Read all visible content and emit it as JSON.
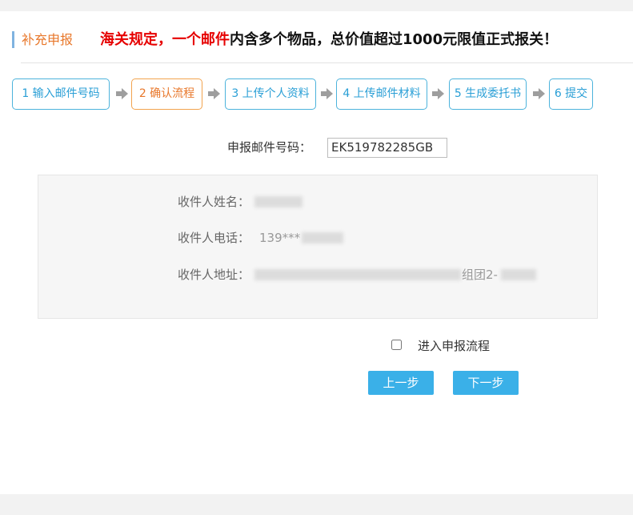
{
  "header": {
    "section_title": "补充申报",
    "notice_red": "海关规定，一个邮件",
    "notice_rest": "内含多个物品，总价值超过1000元限值正式报关！"
  },
  "steps": [
    {
      "label": "1 输入邮件号码",
      "active": false
    },
    {
      "label": "2 确认流程",
      "active": true
    },
    {
      "label": "3 上传个人资料",
      "active": false
    },
    {
      "label": "4 上传邮件材料",
      "active": false
    },
    {
      "label": "5 生成委托书",
      "active": false
    },
    {
      "label": "6 提交",
      "active": false
    }
  ],
  "mail": {
    "label": "申报邮件号码：",
    "value": "EK519782285GB"
  },
  "recipient": {
    "name_label": "收件人姓名：",
    "phone_label": "收件人电话：",
    "phone_visible": "139***",
    "address_label": "收件人地址：",
    "address_visible": "组团2-"
  },
  "agree": {
    "label": "进入申报流程",
    "checked": false
  },
  "buttons": {
    "prev": "上一步",
    "next": "下一步"
  },
  "colors": {
    "accent": "#3ab0e8",
    "step_border": "#4cb3dc",
    "active_step": "#e8772a",
    "notice_red": "#e60000"
  }
}
